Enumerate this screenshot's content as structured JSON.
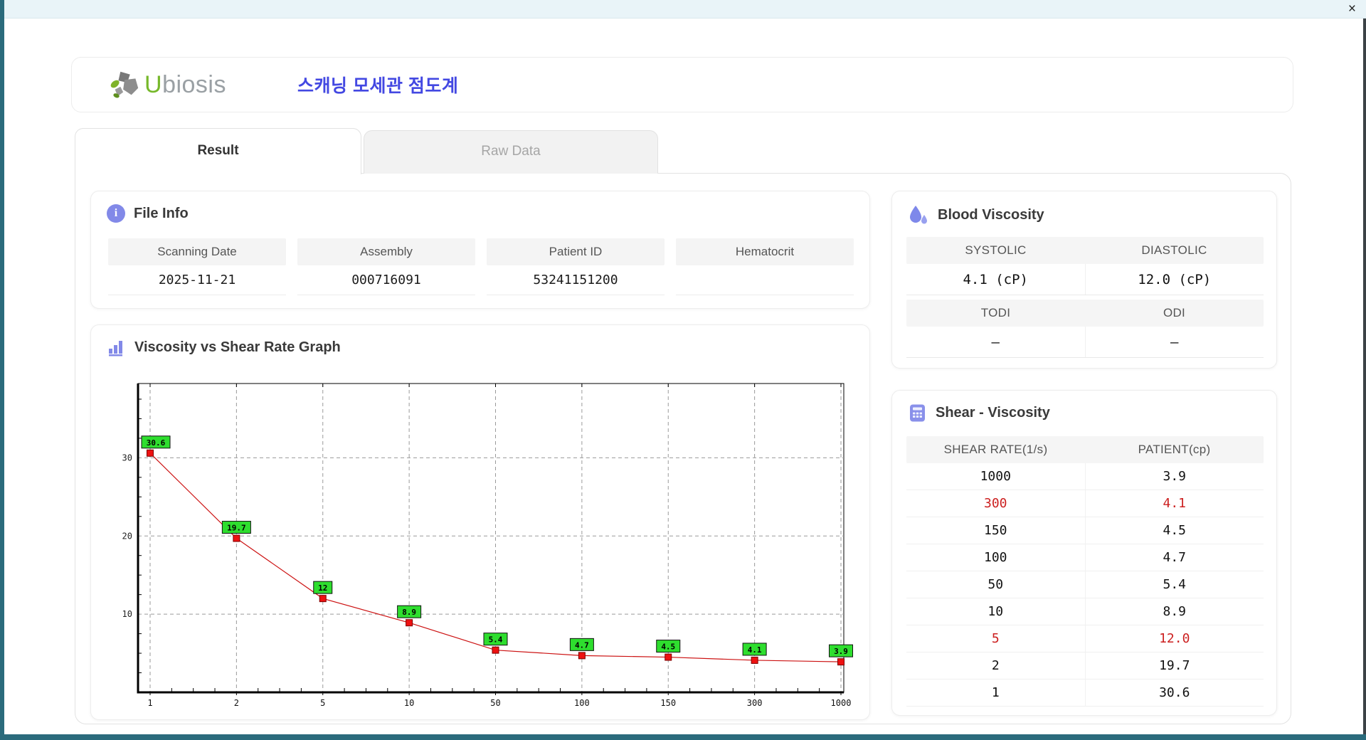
{
  "window": {
    "close_icon": "×"
  },
  "header": {
    "logo_u": "U",
    "logo_rest": "biosis",
    "title_ko": "스캐닝 모세관 점도계"
  },
  "tabs": [
    {
      "label": "Result",
      "active": true
    },
    {
      "label": "Raw Data",
      "active": false
    }
  ],
  "file_info": {
    "title": "File Info",
    "fields": [
      {
        "label": "Scanning Date",
        "value": "2025-11-21"
      },
      {
        "label": "Assembly",
        "value": "000716091"
      },
      {
        "label": "Patient ID",
        "value": "53241151200"
      },
      {
        "label": "Hematocrit",
        "value": ""
      }
    ]
  },
  "blood_viscosity": {
    "title": "Blood Viscosity",
    "pairs": [
      {
        "h1": "SYSTOLIC",
        "v1": "4.1 (cP)",
        "h2": "DIASTOLIC",
        "v2": "12.0 (cP)"
      },
      {
        "h1": "TODI",
        "v1": "–",
        "h2": "ODI",
        "v2": "–"
      }
    ]
  },
  "graph": {
    "title": "Viscosity vs Shear Rate Graph"
  },
  "chart_data": {
    "type": "line",
    "title": "Viscosity vs Shear Rate Graph",
    "x": [
      1,
      2,
      5,
      10,
      50,
      100,
      150,
      300,
      1000
    ],
    "x_tick_labels": [
      "1",
      "2",
      "5",
      "10",
      "50",
      "100",
      "150",
      "300",
      "1000"
    ],
    "values": [
      30.6,
      19.7,
      12,
      8.9,
      5.4,
      4.7,
      4.5,
      4.1,
      3.9
    ],
    "point_labels": [
      "30.6",
      "19.7",
      "12",
      "8.9",
      "5.4",
      "4.7",
      "4.5",
      "4.1",
      "3.9"
    ],
    "y_ticks": [
      10,
      20,
      30
    ],
    "ylim": [
      0,
      39.5
    ],
    "x_spacing": "categorical-even",
    "grid": true,
    "line_color": "#cc1111",
    "marker_color": "#ee1111",
    "marker_edge": "#7d0000",
    "label_bg": "#2ede2e",
    "label_border": "#111111"
  },
  "shear_table": {
    "title": "Shear - Viscosity",
    "columns": [
      "SHEAR RATE(1/s)",
      "PATIENT(cp)"
    ],
    "rows": [
      {
        "shear": "1000",
        "patient": "3.9",
        "highlight": false
      },
      {
        "shear": "300",
        "patient": "4.1",
        "highlight": true
      },
      {
        "shear": "150",
        "patient": "4.5",
        "highlight": false
      },
      {
        "shear": "100",
        "patient": "4.7",
        "highlight": false
      },
      {
        "shear": "50",
        "patient": "5.4",
        "highlight": false
      },
      {
        "shear": "10",
        "patient": "8.9",
        "highlight": false
      },
      {
        "shear": "5",
        "patient": "12.0",
        "highlight": true
      },
      {
        "shear": "2",
        "patient": "19.7",
        "highlight": false
      },
      {
        "shear": "1",
        "patient": "30.6",
        "highlight": false
      }
    ]
  },
  "colors": {
    "accent_purple": "#4348e2",
    "icon_purple": "#8289e8",
    "logo_green": "#76b82a",
    "highlight_red": "#cc2020",
    "frame_teal": "#2b6b7c",
    "chart_line": "#cc1111",
    "chart_marker": "#ee1111",
    "chart_label_bg": "#2ede2e"
  }
}
